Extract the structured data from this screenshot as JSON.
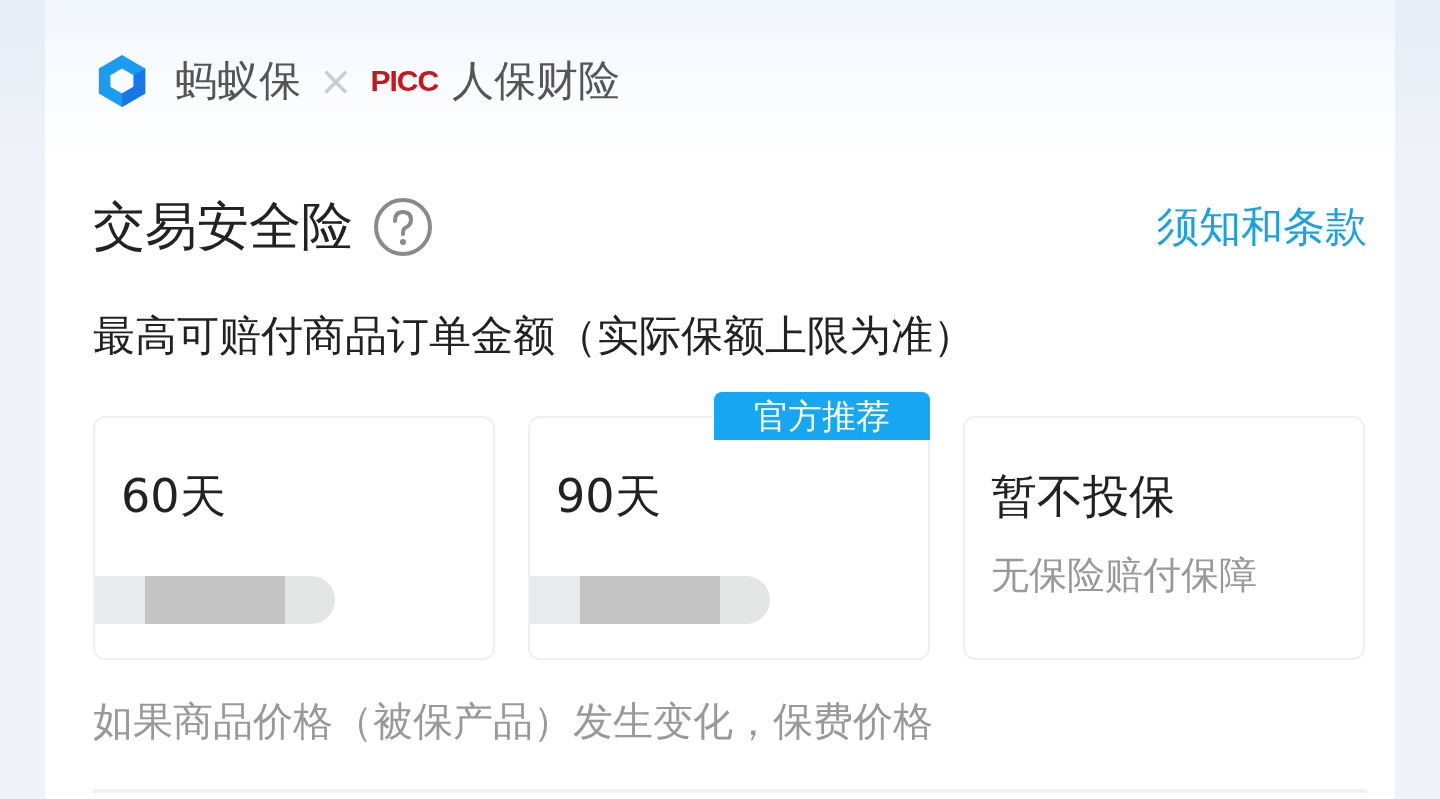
{
  "header": {
    "brand": "蚂蚁保",
    "separator": "×",
    "partner_logo": "PICC",
    "partner": "人保财险"
  },
  "product": {
    "title": "交易安全险",
    "terms_link": "须知和条款"
  },
  "subtitle": "最高可赔付商品订单金额（实际保额上限为准）",
  "options": [
    {
      "label": "60天",
      "price_blurred": true
    },
    {
      "label": "90天",
      "price_blurred": true,
      "badge": "官方推荐"
    },
    {
      "label": "暂不投保",
      "price_blurred": false,
      "note": "无保险赔付保障"
    }
  ],
  "footnote": "如果商品价格（被保产品）发生变化，保费价格"
}
